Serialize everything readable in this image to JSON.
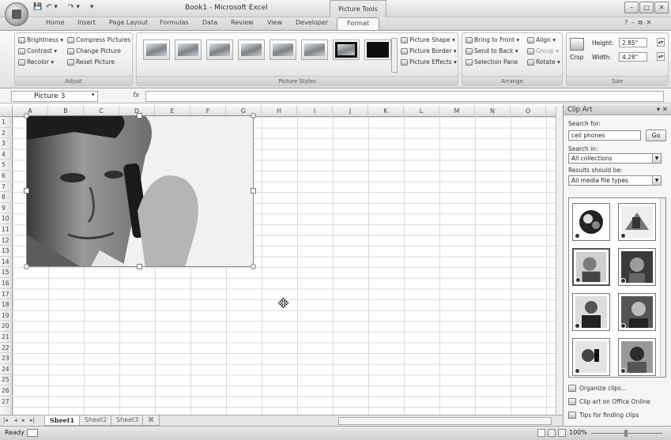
{
  "window": {
    "title": "Book1 - Microsoft Excel",
    "context_tab_group": "Picture Tools",
    "controls": [
      "–",
      "□",
      "✕"
    ]
  },
  "quick_access": [
    "💾",
    "↶ ▾",
    "↷ ▾",
    "▾"
  ],
  "ribbon": {
    "tabs": [
      "Home",
      "Insert",
      "Page Layout",
      "Formulas",
      "Data",
      "Review",
      "View",
      "Developer",
      "Format"
    ],
    "active_tab": "Format",
    "help": "?  –  ⧉  ✕",
    "adjust": {
      "label": "Adjust",
      "buttons": [
        "Brightness ▾",
        "Contrast ▾",
        "Recolor ▾",
        "Compress Pictures",
        "Change Picture",
        "Reset Picture"
      ]
    },
    "picture_styles": {
      "label": "Picture Styles",
      "options": [
        "Picture Shape ▾",
        "Picture Border ▾",
        "Picture Effects ▾"
      ]
    },
    "arrange": {
      "label": "Arrange",
      "buttons": [
        "Bring to Front ▾",
        "Send to Back ▾",
        "Selection Pane",
        "Align ▾",
        "Group ▾",
        "Rotate ▾"
      ]
    },
    "size": {
      "label": "Size",
      "crop": "Crop",
      "height_label": "Height:",
      "height_value": "2.85\"",
      "width_label": "Width:",
      "width_value": "4.28\""
    }
  },
  "formula_bar": {
    "name_box": "Picture 3",
    "fx": "fx",
    "formula": ""
  },
  "grid": {
    "columns": [
      "A",
      "B",
      "C",
      "D",
      "E",
      "F",
      "G",
      "H",
      "I",
      "J",
      "K",
      "L",
      "M",
      "N",
      "O"
    ],
    "rows": [
      "1",
      "2",
      "3",
      "4",
      "5",
      "6",
      "7",
      "8",
      "9",
      "10",
      "11",
      "12",
      "13",
      "14",
      "15",
      "16",
      "17",
      "18",
      "19",
      "20",
      "21",
      "22",
      "23",
      "24",
      "25",
      "26",
      "27"
    ]
  },
  "sheets": {
    "nav": [
      "|◂",
      "◂",
      "▸",
      "▸|"
    ],
    "tabs": [
      "Sheet1",
      "Sheet2",
      "Sheet3",
      "⌘"
    ],
    "active": "Sheet1"
  },
  "status": {
    "text": "Ready",
    "zoom": "100%"
  },
  "clip_art": {
    "title": "Clip Art",
    "close": "▾ ✕",
    "search_for_label": "Search for:",
    "search_value": "cell phones",
    "go_label": "Go",
    "search_in_label": "Search in:",
    "search_in_value": "All collections",
    "results_label": "Results should be:",
    "results_value": "All media file types",
    "links": [
      "Organize clips...",
      "Clip art on Office Online",
      "Tips for finding clips"
    ]
  },
  "colors": {
    "ribbon_bg": "#e3e3e3",
    "grid_line": "#dadada",
    "selection": "#777777"
  }
}
